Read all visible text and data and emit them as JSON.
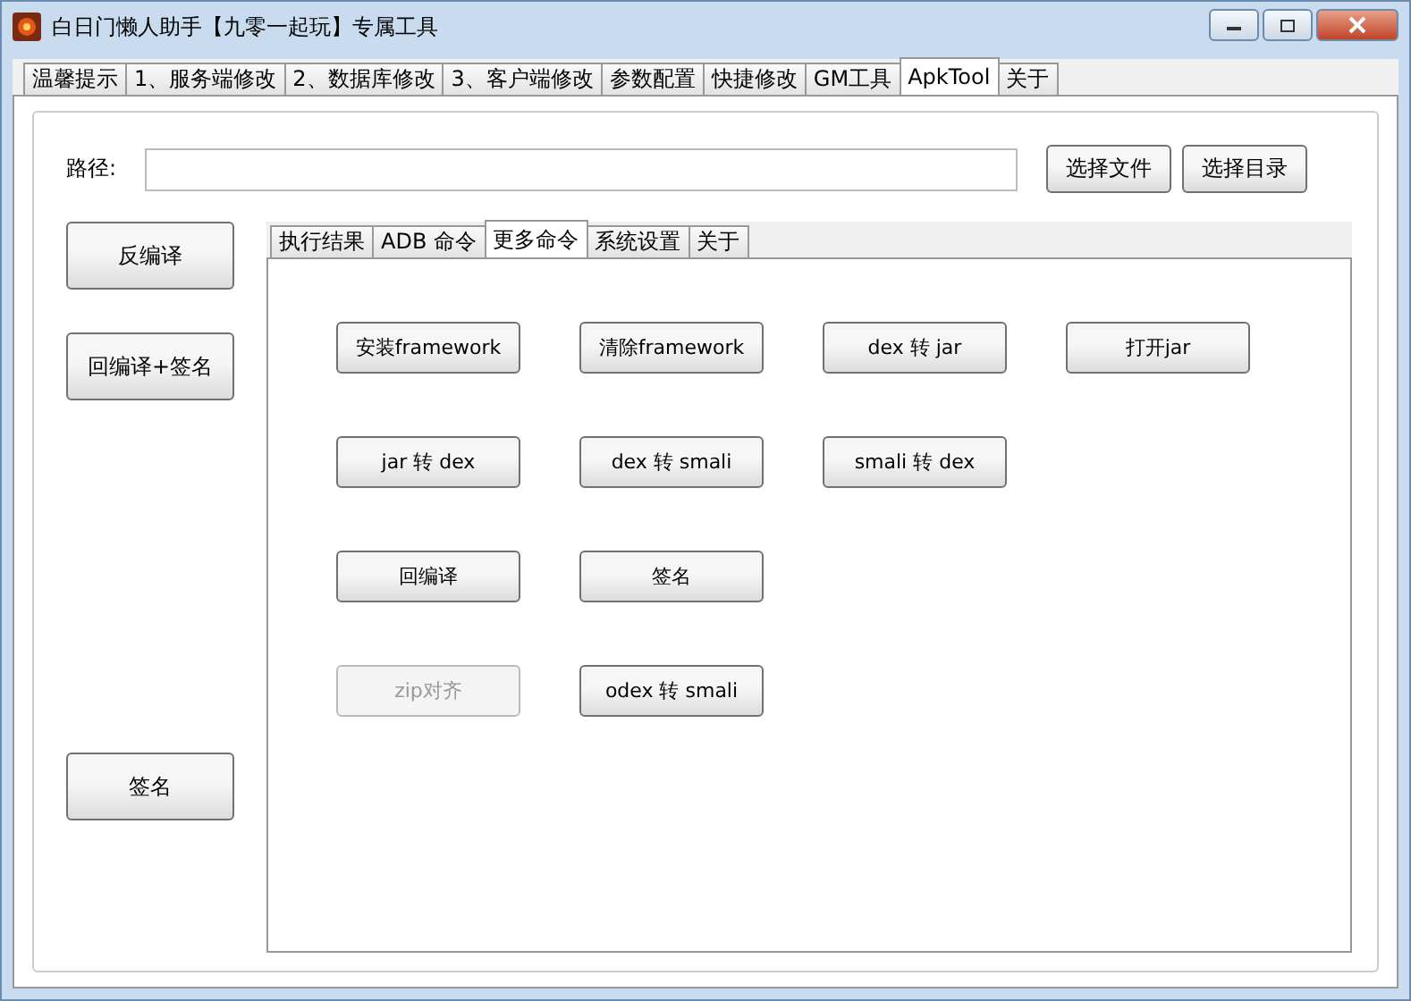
{
  "window": {
    "title": "白日门懒人助手【九零一起玩】专属工具"
  },
  "tabs": [
    {
      "label": "温馨提示",
      "selected": false
    },
    {
      "label": "1、服务端修改",
      "selected": false
    },
    {
      "label": "2、数据库修改",
      "selected": false
    },
    {
      "label": "3、客户端修改",
      "selected": false
    },
    {
      "label": "参数配置",
      "selected": false
    },
    {
      "label": "快捷修改",
      "selected": false
    },
    {
      "label": "GM工具",
      "selected": false
    },
    {
      "label": "ApkTool",
      "selected": true
    },
    {
      "label": "关于",
      "selected": false
    }
  ],
  "path": {
    "label": "路径:"
  },
  "path_buttons": [
    "选择文件",
    "选择目录"
  ],
  "side_buttons": [
    "反编译",
    "回编译+签名",
    "签名"
  ],
  "inner_tabs": [
    {
      "label": "执行结果",
      "selected": false
    },
    {
      "label": "ADB 命令",
      "selected": false
    },
    {
      "label": "更多命令",
      "selected": true
    },
    {
      "label": "系统设置",
      "selected": false
    },
    {
      "label": "关于",
      "selected": false
    }
  ],
  "command_rows": [
    [
      {
        "label": "安装framework",
        "disabled": false
      },
      {
        "label": "清除framework",
        "disabled": false
      },
      {
        "label": "dex 转 jar",
        "disabled": false
      },
      {
        "label": "打开jar",
        "disabled": false
      }
    ],
    [
      {
        "label": "jar 转 dex",
        "disabled": false
      },
      {
        "label": "dex 转 smali",
        "disabled": false
      },
      {
        "label": "smali 转 dex",
        "disabled": false
      }
    ],
    [
      {
        "label": "回编译",
        "disabled": false
      },
      {
        "label": "签名",
        "disabled": false
      }
    ],
    [
      {
        "label": "zip对齐",
        "disabled": true
      },
      {
        "label": "odex 转 smali",
        "disabled": false
      }
    ]
  ]
}
